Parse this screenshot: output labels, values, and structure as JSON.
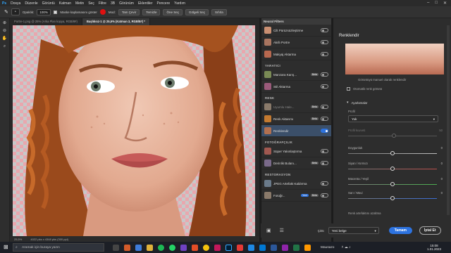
{
  "menubar": {
    "items": [
      "Dosya",
      "Düzenle",
      "Görüntü",
      "Katman",
      "Metin",
      "Seç",
      "Filtre",
      "3B",
      "Görünüm",
      "Eklentiler",
      "Pencere",
      "Yardım"
    ]
  },
  "options": {
    "opacity_label": "Opaklık:",
    "opacity_value": "100%",
    "mask_label": "Maske kaplamasını göster",
    "mode_label": "Mod:",
    "btn_fill": "Tam Çevir",
    "btn_clean": "Temizle",
    "btn_refine": "Öne Seç",
    "btn_select": "Gölgeli Seç",
    "btn_cancel": "Sıfırla"
  },
  "tabs": [
    {
      "label": "Portre-1.png @ 25% (Arka Plan kopya, RGB/8#)"
    },
    {
      "label": "Başlıksız-1 @ 25,5% (Katman 3, RGB/8#) *"
    }
  ],
  "status": {
    "zoom": "25,5%",
    "doc_size": "4022 pks x 4348 pks (300 ppi)"
  },
  "neural": {
    "header": "Neural Filters",
    "items_top": [
      {
        "label": "Cilt Pürüzsüzleştirme",
        "color": "#c98f72"
      },
      {
        "label": "Akıllı Portre",
        "color": "#a87560"
      },
      {
        "label": "Makyaj Aktarma",
        "color": "#b7684f"
      }
    ],
    "sections": {
      "yaratici": "YARATICI",
      "renk": "RENK",
      "fotografik": "FOTOĞRAFÇILIK",
      "restorasyon": "RESTORASYON"
    },
    "items_creative": [
      {
        "label": "Manzara Karış...",
        "badge": "Beta",
        "color": "#7a8a55"
      },
      {
        "label": "Stil Aktarma",
        "color": "#9a5a7a"
      }
    ],
    "items_color": [
      {
        "label": "Uyumlu Hale...",
        "badge": "Beta",
        "color": "#8a7a6a"
      },
      {
        "label": "Renk Aktarımı",
        "badge": "Beta",
        "color": "#c47a30"
      },
      {
        "label": "Renklendir",
        "color": "#b27050"
      }
    ],
    "items_photo": [
      {
        "label": "Süper Yakınlaştırma",
        "color": "#a05850"
      },
      {
        "label": "Derinlik Bulanı...",
        "badge": "Beta",
        "color": "#7a6a8a"
      }
    ],
    "items_restore": [
      {
        "label": "JPEG Artefakt Kaldırma",
        "color": "#6a7a8a"
      },
      {
        "label": "Fotoğr...",
        "badge": "Yeni",
        "badge2": "Beta",
        "color": "#8a7a6a"
      }
    ]
  },
  "props": {
    "title": "Renklendir",
    "preview_caption": "Görüntüyü manuel olarak renklendir",
    "auto_label": "Otomatik renk görünü",
    "settings_label": "Ayarlamalar",
    "profile_label": "Profil",
    "profile_value": "Yok",
    "profile_strength_label": "Profil kuvveti",
    "profile_strength_value": "50",
    "sliders": [
      {
        "label": "Doygunluk",
        "value": "0",
        "fraction": 0.5,
        "color": "#bfbfbf"
      },
      {
        "label": "Siyan / Kırmızı",
        "value": "0",
        "fraction": 0.5,
        "color": "#c0504d"
      },
      {
        "label": "Macenta / Yeşil",
        "value": "0",
        "fraction": 0.5,
        "color": "#4caf50"
      },
      {
        "label": "Sarı / Mavi",
        "value": "0",
        "fraction": 0.5,
        "color": "#3b6fd8"
      }
    ],
    "next_label": "Renk artefaktını azaltma"
  },
  "bottom": {
    "output_label": "Çıktı",
    "output_value": "Yeni belge",
    "ok": "Tamam",
    "cancel": "İptal Et"
  },
  "taskbar": {
    "search_placeholder": "Aramak için buraya yazın",
    "weather": "Mausazo",
    "time": "15:08",
    "date": "1.01.2023"
  }
}
